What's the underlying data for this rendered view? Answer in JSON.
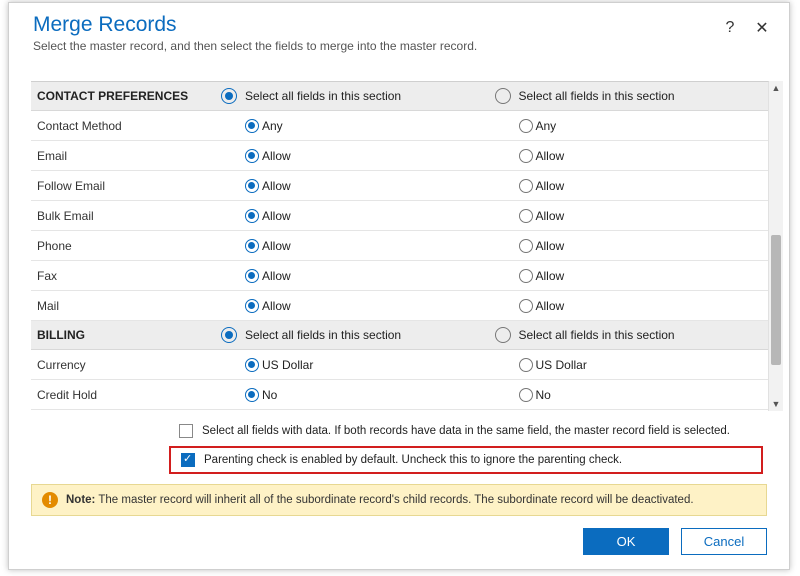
{
  "header": {
    "title": "Merge Records",
    "subtitle": "Select the master record, and then select the fields to merge into the master record."
  },
  "sections": {
    "contact_preferences": {
      "label": "CONTACT PREFERENCES",
      "select_all_a": "Select all fields in this section",
      "select_all_b": "Select all fields in this section",
      "rows": [
        {
          "label": "Contact Method",
          "a": "Any",
          "b": "Any"
        },
        {
          "label": "Email",
          "a": "Allow",
          "b": "Allow"
        },
        {
          "label": "Follow Email",
          "a": "Allow",
          "b": "Allow"
        },
        {
          "label": "Bulk Email",
          "a": "Allow",
          "b": "Allow"
        },
        {
          "label": "Phone",
          "a": "Allow",
          "b": "Allow"
        },
        {
          "label": "Fax",
          "a": "Allow",
          "b": "Allow"
        },
        {
          "label": "Mail",
          "a": "Allow",
          "b": "Allow"
        }
      ]
    },
    "billing": {
      "label": "BILLING",
      "select_all_a": "Select all fields in this section",
      "select_all_b": "Select all fields in this section",
      "rows": [
        {
          "label": "Currency",
          "a": "US Dollar",
          "b": "US Dollar"
        },
        {
          "label": "Credit Hold",
          "a": "No",
          "b": "No"
        }
      ]
    }
  },
  "options": {
    "select_all_data": "Select all fields with data. If both records have data in the same field, the master record field is selected.",
    "parenting_check": "Parenting check is enabled by default. Uncheck this to ignore the parenting check."
  },
  "note": {
    "label": "Note:",
    "text": " The master record will inherit all of the subordinate record's child records. The subordinate record will be deactivated."
  },
  "footer": {
    "ok": "OK",
    "cancel": "Cancel"
  }
}
